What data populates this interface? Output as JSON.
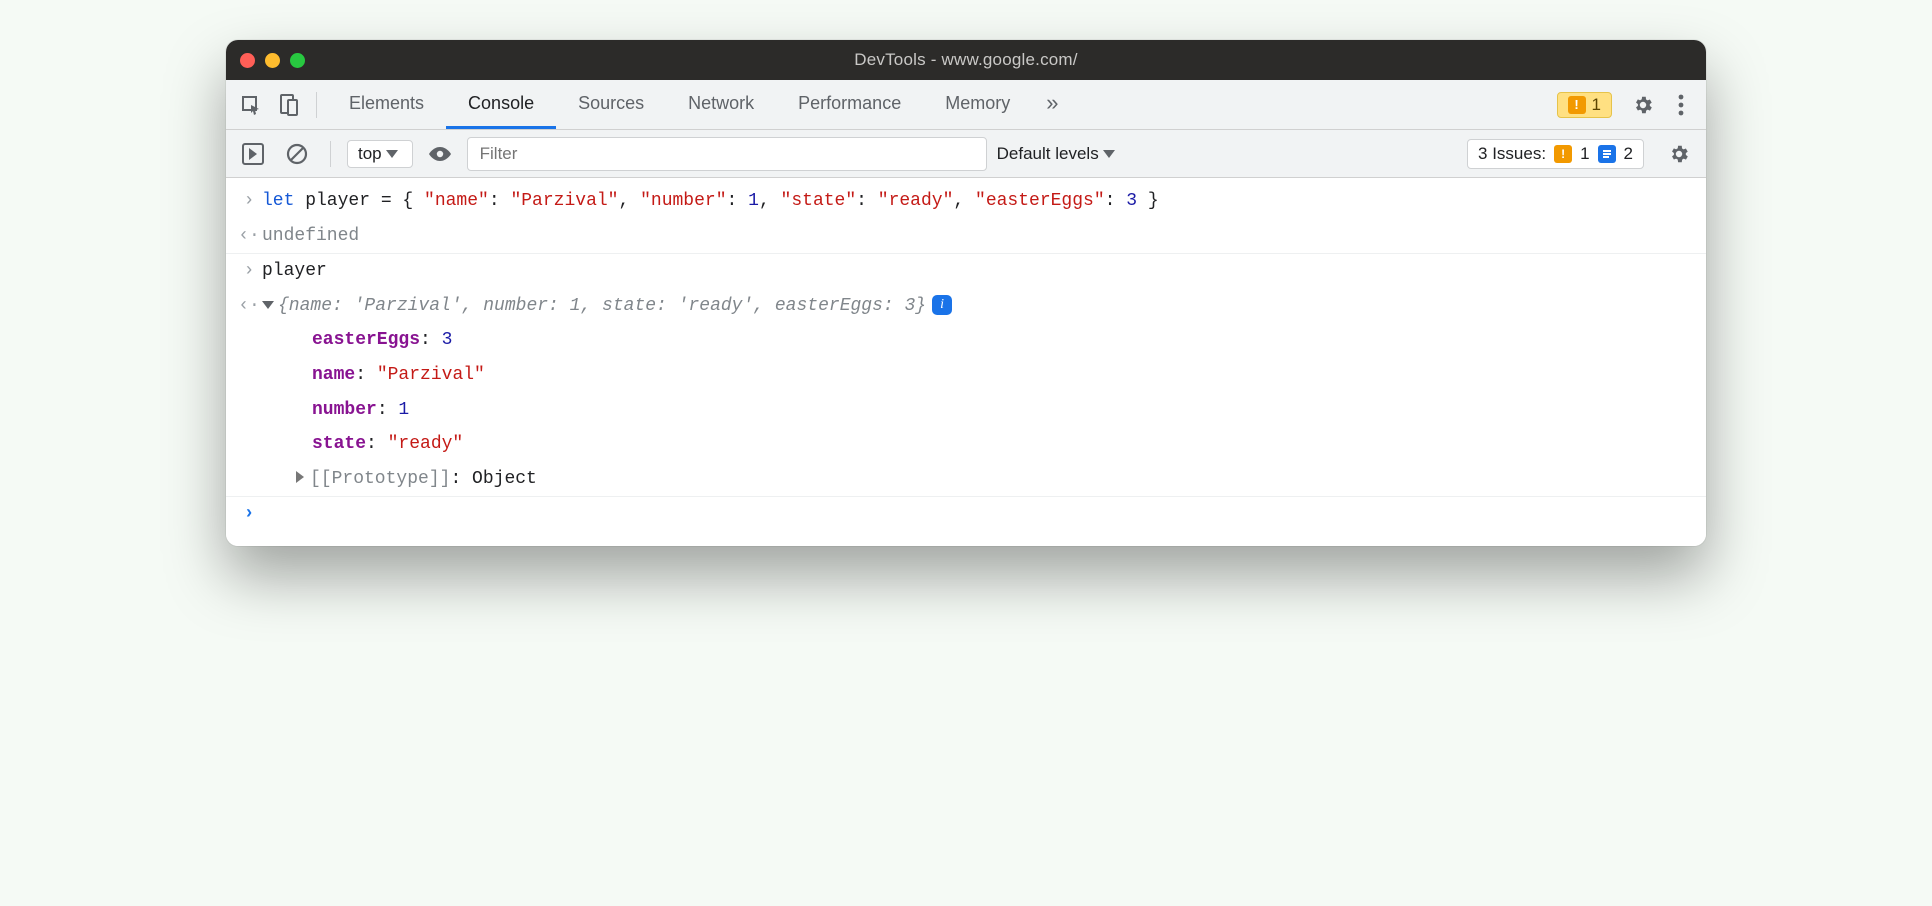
{
  "titlebar": {
    "title": "DevTools - www.google.com/"
  },
  "tabs": {
    "t0": "Elements",
    "t1": "Console",
    "t2": "Sources",
    "t3": "Network",
    "t4": "Performance",
    "t5": "Memory"
  },
  "topbar": {
    "warn_badge_count": "1"
  },
  "filterbar": {
    "context": "top",
    "filter_placeholder": "Filter",
    "levels": "Default levels",
    "issues_label": "3 Issues:",
    "issues_warn": "1",
    "issues_info": "2"
  },
  "console": {
    "line1_let": "let",
    "line1_var": " player = { ",
    "line1_k1": "\"name\"",
    "line1_c1": ": ",
    "line1_v1": "\"Parzival\"",
    "line1_s1": ", ",
    "line1_k2": "\"number\"",
    "line1_c2": ": ",
    "line1_v2": "1",
    "line1_s2": ", ",
    "line1_k3": "\"state\"",
    "line1_c3": ": ",
    "line1_v3": "\"ready\"",
    "line1_s3": ", ",
    "line1_k4": "\"easterEggs\"",
    "line1_c4": ": ",
    "line1_v4": "3",
    "line1_end": " }",
    "line2": "undefined",
    "line3": "player",
    "summary": "{name: 'Parzival', number: 1, state: 'ready', easterEggs: 3}",
    "p1k": "easterEggs",
    "p1c": ": ",
    "p1v": "3",
    "p2k": "name",
    "p2c": ": ",
    "p2v": "\"Parzival\"",
    "p3k": "number",
    "p3c": ": ",
    "p3v": "1",
    "p4k": "state",
    "p4c": ": ",
    "p4v": "\"ready\"",
    "proto_label": "[[Prototype]]",
    "proto_c": ": ",
    "proto_v": "Object"
  }
}
